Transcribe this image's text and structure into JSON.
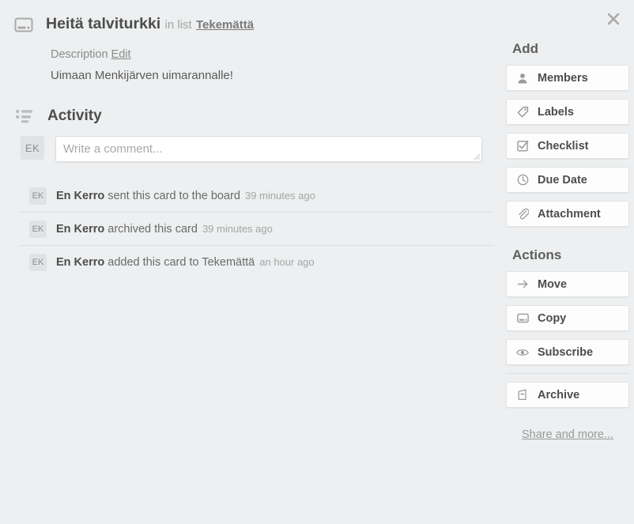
{
  "window": {
    "close_label": "×"
  },
  "card": {
    "icon": "card-icon",
    "title": "Heitä talviturkki",
    "in_list_prefix": "in list",
    "list_name": "Tekemättä"
  },
  "description": {
    "label": "Description",
    "edit_label": "Edit",
    "body": "Uimaan Menkijärven uimarannalle!"
  },
  "activity": {
    "icon": "activity-list-icon",
    "title": "Activity",
    "composer": {
      "avatar_initials": "EK",
      "placeholder": "Write a comment..."
    },
    "items": [
      {
        "avatar_initials": "EK",
        "author": "En Kerro",
        "action": "sent this card to the board",
        "time": "39 minutes ago"
      },
      {
        "avatar_initials": "EK",
        "author": "En Kerro",
        "action": "archived this card",
        "time": "39 minutes ago"
      },
      {
        "avatar_initials": "EK",
        "author": "En Kerro",
        "action": "added this card to Tekemättä",
        "time": "an hour ago"
      }
    ]
  },
  "sidebar": {
    "add_heading": "Add",
    "add_items": [
      {
        "label": "Members",
        "icon": "person-icon"
      },
      {
        "label": "Labels",
        "icon": "tag-icon"
      },
      {
        "label": "Checklist",
        "icon": "checkbox-checked-icon"
      },
      {
        "label": "Due Date",
        "icon": "clock-icon"
      },
      {
        "label": "Attachment",
        "icon": "paperclip-icon"
      }
    ],
    "actions_heading": "Actions",
    "action_items": [
      {
        "label": "Move",
        "icon": "arrow-right-icon"
      },
      {
        "label": "Copy",
        "icon": "card-icon"
      },
      {
        "label": "Subscribe",
        "icon": "eye-icon"
      }
    ],
    "archive_item": {
      "label": "Archive",
      "icon": "archive-box-icon"
    },
    "share_link": "Share and more..."
  },
  "colors": {
    "page_background": "#edeff0",
    "button_background": "#fdfdfd",
    "text_primary": "#4d4d4d",
    "text_muted": "#a5a5a5",
    "avatar_background": "#dfe3e6",
    "divider": "#dcdee0"
  }
}
